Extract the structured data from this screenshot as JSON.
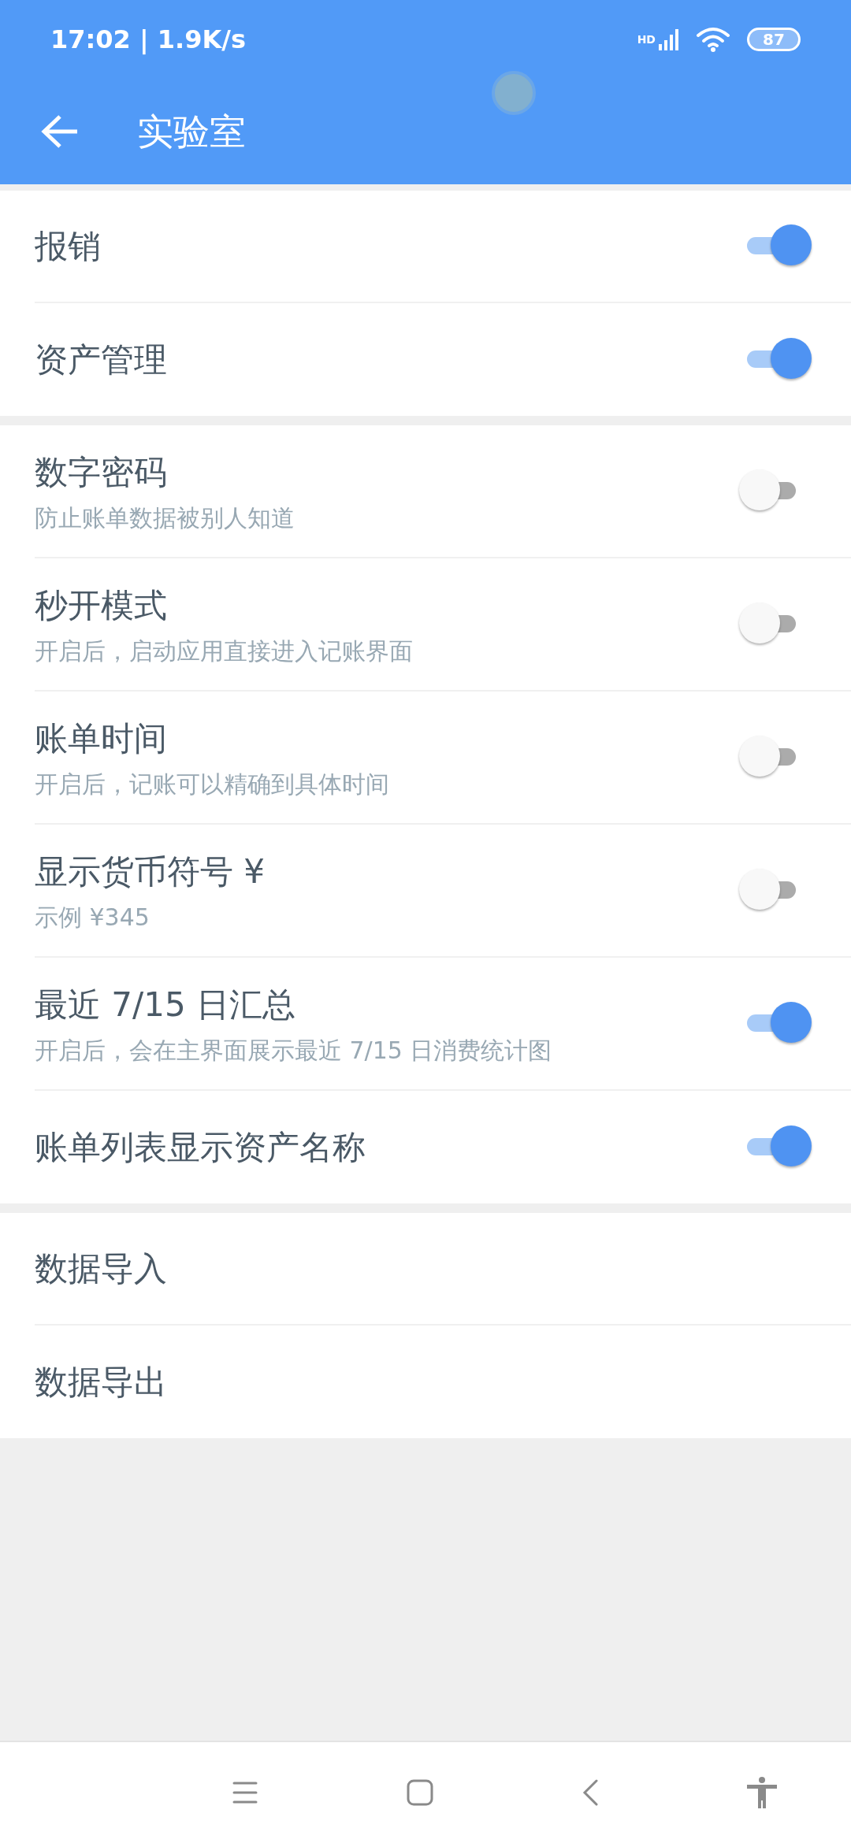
{
  "status_bar": {
    "time": "17:02 | 1.9K/s",
    "network": "HD",
    "battery": "87"
  },
  "app_bar": {
    "title": "实验室"
  },
  "sections": [
    {
      "items": [
        {
          "kind": "toggle",
          "title": "报销",
          "on": true
        },
        {
          "kind": "toggle",
          "title": "资产管理",
          "on": true
        }
      ]
    },
    {
      "items": [
        {
          "kind": "toggle",
          "title": "数字密码",
          "subtitle": "防止账单数据被别人知道",
          "on": false
        },
        {
          "kind": "toggle",
          "title": "秒开模式",
          "subtitle": "开启后，启动应用直接进入记账界面",
          "on": false
        },
        {
          "kind": "toggle",
          "title": "账单时间",
          "subtitle": "开启后，记账可以精确到具体时间",
          "on": false
        },
        {
          "kind": "toggle",
          "title": "显示货币符号 ¥",
          "subtitle": "示例 ¥345",
          "on": false
        },
        {
          "kind": "toggle",
          "title": "最近 7/15 日汇总",
          "subtitle": "开启后，会在主界面展示最近 7/15 日消费统计图",
          "on": true
        },
        {
          "kind": "toggle",
          "title": "账单列表显示资产名称",
          "on": true
        }
      ]
    },
    {
      "items": [
        {
          "kind": "link",
          "title": "数据导入"
        },
        {
          "kind": "link",
          "title": "数据导出"
        }
      ]
    }
  ]
}
